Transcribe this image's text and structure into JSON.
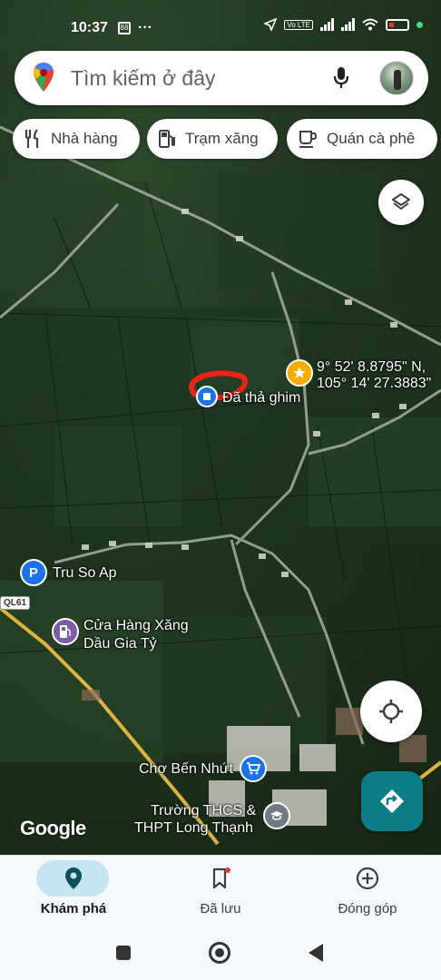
{
  "status_bar": {
    "time": "10:37",
    "left_icons": [
      "sim-icon",
      "more-dots-icon"
    ],
    "right_icons": [
      "location-arrow-icon",
      "volte-icon",
      "signal-icon",
      "wifi-icon",
      "battery-icon"
    ],
    "battery_accent": "#e53935"
  },
  "search": {
    "placeholder": "Tìm kiếm ở đây",
    "brand_color": "#ea4335"
  },
  "chips": [
    {
      "label": "Nhà hàng",
      "icon": "fork-knife-icon"
    },
    {
      "label": "Trạm xăng",
      "icon": "gas-pump-icon"
    },
    {
      "label": "Quán cà phê",
      "icon": "coffee-cup-icon"
    }
  ],
  "map": {
    "dropped_pin_label": "Đã thả ghim",
    "coordinates_line1": "9° 52' 8.8795\" N,",
    "coordinates_line2": "105° 14' 27.3883\"",
    "places": [
      {
        "name": "Tru So Ap",
        "icon": "parking-icon"
      },
      {
        "name_line1": "Cửa Hàng Xăng",
        "name_line2": "Dầu Gia Tỷ",
        "icon": "gas-station-icon"
      },
      {
        "name": "Chợ Bến Nhứt",
        "icon": "shopping-cart-icon"
      },
      {
        "name_line1": "Trường THCS &",
        "name_line2": "THPT Long Thạnh",
        "icon": "school-icon"
      }
    ],
    "road_badge": "QL61",
    "attribution": "Google"
  },
  "bottom_nav": [
    {
      "label": "Khám phá",
      "icon": "explore-pin-icon",
      "active": true
    },
    {
      "label": "Đã lưu",
      "icon": "bookmark-icon",
      "active": false
    },
    {
      "label": "Đóng góp",
      "icon": "add-circle-icon",
      "active": false
    }
  ],
  "colors": {
    "accent_teal": "#0b7d86",
    "active_pill": "#c4e4ef",
    "star_yellow": "#f9ab00",
    "poi_blue": "#1a73e8",
    "poi_purple": "#7b5ea7",
    "poi_gray": "#6f7b86"
  }
}
